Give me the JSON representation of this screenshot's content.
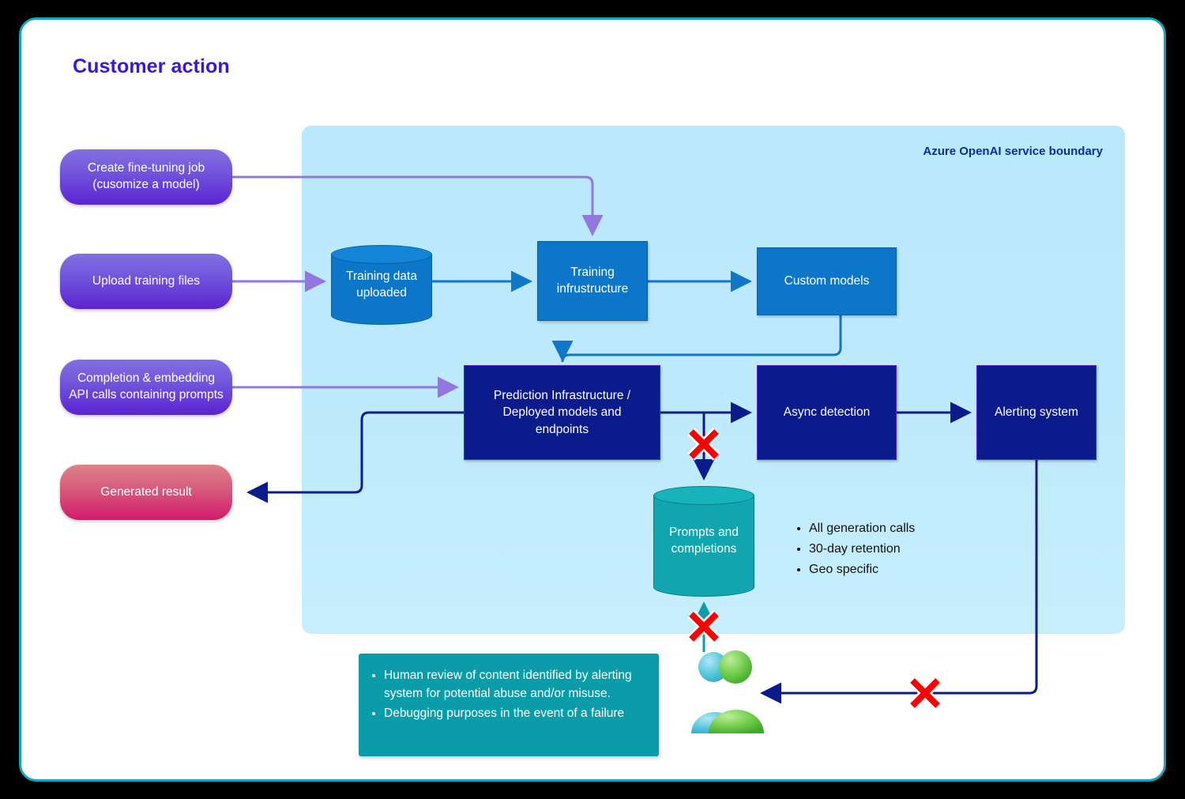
{
  "title": "Customer action",
  "boundary": {
    "label": "Azure OpenAI service boundary"
  },
  "customer_actions": [
    {
      "id": "create-fine-tuning-job",
      "line1": "Create fine-tuning job",
      "line2": "(cusomize a model)",
      "color": "#5C23D2"
    },
    {
      "id": "upload-training-files",
      "line1": "Upload training files",
      "line2": "",
      "color": "#5C23D2"
    },
    {
      "id": "api-calls",
      "line1": "Completion & embedding",
      "line2": "API calls containing prompts",
      "color": "#5C23D2"
    },
    {
      "id": "generated-result",
      "line1": "Generated result",
      "line2": "",
      "color": "#D31A6C"
    }
  ],
  "service_nodes": {
    "training_data": {
      "line1": "Training data",
      "line2": "uploaded",
      "color": "#0C77C8"
    },
    "training_infrastructure": {
      "line1": "Training",
      "line2": "infrustructure",
      "color": "#0C77C8"
    },
    "custom_models": {
      "line1": "Custom models",
      "line2": "",
      "color": "#0C77C8"
    },
    "prediction_infrastructure": {
      "line1": "Prediction Infrastructure /",
      "line2": "Deployed models and",
      "line3": "endpoints",
      "color": "#0B1B8C"
    },
    "async_detection": {
      "line1": "Async detection",
      "line2": "",
      "color": "#0B1B8C"
    },
    "alerting_system": {
      "line1": "Alerting system",
      "line2": "",
      "color": "#0B1B8C"
    },
    "prompts_and_completions": {
      "line1": "Prompts and",
      "line2": "completions",
      "color": "#10A5AF"
    }
  },
  "retention_notes": [
    "All generation calls",
    "30-day retention",
    "Geo specific"
  ],
  "human_review_notes": [
    "Human review of content identified by alerting system for potential abuse and/or misuse.",
    "Debugging purposes in the event of a failure"
  ],
  "colors": {
    "frame_border": "#0FA8BE",
    "boundary_fill": "#BDEAFC",
    "purple_wire": "#9277DE",
    "blue_wire": "#1076C9",
    "navy_wire": "#0B1B8C",
    "teal_wire": "#0E9CA7",
    "x_mark": "#FF0000",
    "title": "#3A16D8"
  },
  "icons": {
    "people": "people-icon",
    "blocked_1": "x-mark-icon",
    "blocked_2": "x-mark-icon",
    "blocked_3": "x-mark-icon"
  }
}
